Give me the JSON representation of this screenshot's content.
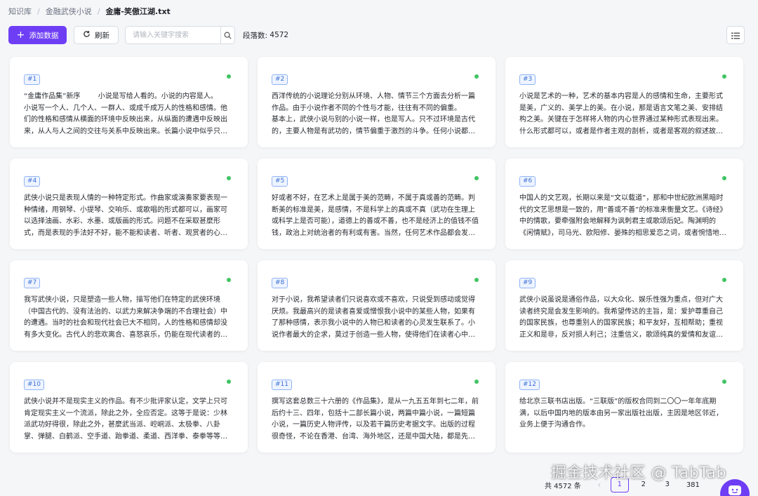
{
  "breadcrumb": {
    "items": [
      "知识库",
      "金融武侠小说",
      "金庸-笑傲江湖.txt"
    ],
    "separator": "/"
  },
  "toolbar": {
    "add_label": "添加数据",
    "refresh_label": "刷新",
    "search_placeholder": "请输入关键字搜索",
    "count_label": "段落数:",
    "count_value": "4572"
  },
  "cards": [
    {
      "id": "#1",
      "text": "“金庸作品集”新序        小说是写给人看的。小说的内容是人。          小说写一个人、几个人、一群人、或成千成万人的性格和感情。他们的性格和感情从横面的环境中反映出来，从纵面的遭遇中反映出来，从人与人之间的交往与关系中反映出来。长篇小说中似乎只有《鲁滨逊漂流记》，才只写一个人"
    },
    {
      "id": "#2",
      "text": "西洋传统的小说理论分别从环境、人物、情节三个方面去分析一篇作品。由于小说作者不同的个性与才能，往往有不同的偏重。        基本上，武侠小说与别的小说一样，也是写人。只不过环境是古代的，主要人物是有武功的，情节偏重于激烈的斗争。任何小说都有它所特别侧重的一面"
    },
    {
      "id": "#3",
      "text": "小说是艺术的一种，艺术的基本内容是人的感情和生命，主要形式是美，广义的、美学上的美。在小说，那是语言文笔之美、安排结构之美。关键在于怎样将人物的内心世界通过某种形式表现出来。什么形式都可以，或者是作者主观的剖析，或者是客观的叙述故事，从人物的行动和言语中客观的表达"
    },
    {
      "id": "#4",
      "text": "武侠小说只是表现人情的一种特定形式。作曲家或演奏家要表现一种情绪，用钢琴、小提琴、交响乐、或歌唱的形式都可以，画家可以选择油画、水彩、水墨、或版画的形式。问题不在采取甚麼形式，而是表现的手法好不好，能不能和读者、听者、观赏者的心灵相沟通，能不能使他的心产生共鸣"
    },
    {
      "id": "#5",
      "text": "好或者不好，在艺术上是属于美的范畴，不属于真或善的范畴。判断美的标准是美，是感情，不是科学上的真或不真（武功在生理上或科学上是否可能），道德上的善或不善，也不是经济上的值钱不值钱，政治上对统治者的有利或有害。当然，任何艺术作品都会发生社会影响的，自也可以从社会影响的价值上去评估"
    },
    {
      "id": "#6",
      "text": "中国人的文艺观，长期以来是“文以载道”，那和中世纪欧洲黑暗时代的文艺思想是一致的，用“善或不善”的标准来衡量文艺。《诗经》中的情歌，要牵强附会地解释为讽刺君主或歌颂后妃。陶渊明的《闲情赋》，司马光、欧阳修、晏殊的相思爱恋之词，或者惋惜地评之为白璧之玷"
    },
    {
      "id": "#7",
      "text": "我写武侠小说，只是塑造一些人物，描写他们在特定的武侠环境（中国古代的、没有法治的、以武力来解决争端的不合理社会）中的遭遇。当时的社会和现代社会已大不相同，人的性格和感情却没有多大变化。古代人的悲欢离合、喜怒哀乐，仍能在现代读者的心灵中引起相应的情绪"
    },
    {
      "id": "#8",
      "text": "对于小说，我希望读者们只说喜欢或不喜欢，只说受到感动或觉得厌烦。我最高兴的是读者喜爱或憎恨我小说中的某些人物，如果有了那种感情，表示我小说中的人物已和读者的心灵发生联系了。小说作者最大的企求，莫过于创造一些人物，使得他们在读者心中变成活生生的、有血有肉的人"
    },
    {
      "id": "#9",
      "text": "武侠小说虽说是通俗作品，以大众化、娱乐性强为重点，但对广大读者终究是会发生影响的。我希望传达的主旨，是：爱护尊重自己的国家民族，也尊重别人的国家民族；和平友好，互相帮助；重视正义和是非，反对损人利己；注重信义，歌颂纯真的爱情和友谊；歌颂奋不顾身的为了正义而奋斗"
    },
    {
      "id": "#10",
      "text": "武侠小说并不是现实主义的作品。有不少批评家认定，文学上只可肯定现实主义一个流派，除此之外，全应否定。这等于是说：少林派武功好得很，除此之外，甚麼武当派、崆峒派、太极拳、八卦掌、弹腿、白鹤派、空手道、跆拳道、柔道、西洋拳、泰拳等等全部应当废除取消"
    },
    {
      "id": "#11",
      "text": "撰写这套总数三十六册的《作品集》，是从一九五五年到七二年，前后约十三、四年，包括十二部长篇小说，两篇中篇小说，一篇短篇小说，一篇历史人物评传，以及若干篇历史考据文字。出版的过程很奇怪，不论在香港、台湾、海外地区，还是中国大陆，都是先出各种各样翻版盗印本"
    },
    {
      "id": "#12",
      "text": "给北京三联书店出版。“三联版”的版权合同到二〇〇一年年底期满，以后中国内地的版本由另一家出版社出版，主因是地区邻近，业务上便于沟通合作。"
    }
  ],
  "pagination": {
    "total_label": "共 4572 条",
    "prev": "‹",
    "pages": [
      "1",
      "2",
      "3"
    ],
    "current_page": "1",
    "ellipsis": "",
    "last": "381"
  },
  "watermark": "掘金技术社区 @ TabTab",
  "colors": {
    "accent": "#6e3ef5",
    "status_dot": "#40c463",
    "badge_border": "#8fb3f7",
    "badge_text": "#3b6fd8",
    "background": "#f5f6f8"
  },
  "icons": {
    "add": "plus-icon",
    "refresh": "refresh-icon",
    "search": "search-icon",
    "list_view": "list-view-icon",
    "chat": "chat-face-icon"
  }
}
